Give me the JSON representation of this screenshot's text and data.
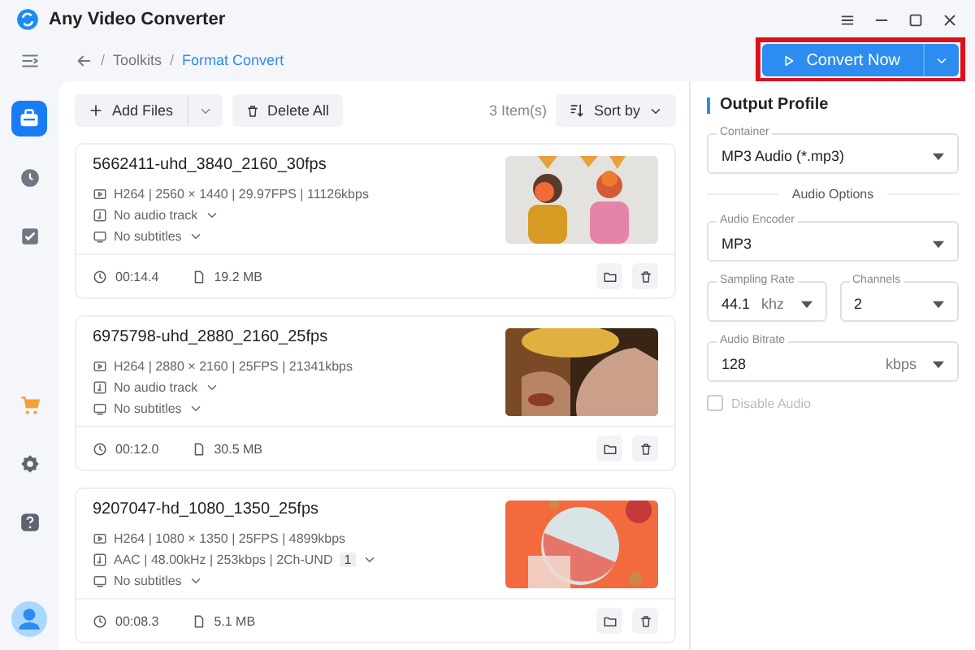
{
  "app": {
    "title": "Any Video Converter"
  },
  "sidebar": {
    "items": [
      {
        "kind": "menu",
        "selected": false
      },
      {
        "kind": "toolbox",
        "selected": true
      },
      {
        "kind": "history",
        "selected": false
      },
      {
        "kind": "tasks",
        "selected": false
      },
      {
        "kind": "cart",
        "selected": false
      },
      {
        "kind": "settings",
        "selected": false
      },
      {
        "kind": "help",
        "selected": false
      },
      {
        "kind": "avatar",
        "selected": false
      }
    ]
  },
  "breadcrumb": [
    {
      "separator": "/",
      "label": "Toolkits",
      "selected": false
    },
    {
      "separator": "/",
      "label": "Format Convert",
      "selected": true
    }
  ],
  "convert_button": {
    "label": "Convert Now",
    "highlighted": true
  },
  "toolbar": {
    "add_files": "Add Files",
    "delete_all": "Delete All",
    "count": "3 Item(s)",
    "sort": "Sort by"
  },
  "files": [
    {
      "name": "5662411-uhd_3840_2160_30fps",
      "video": "H264 | 2560 × 1440 | 29.97FPS | 11126kbps",
      "audio": "No audio track",
      "subtitles": "No subtitles",
      "duration": "00:14.4",
      "size": "19.2 MB"
    },
    {
      "name": "6975798-uhd_2880_2160_25fps",
      "video": "H264 | 2880 × 2160 | 25FPS | 21341kbps",
      "audio": "No audio track",
      "subtitles": "No subtitles",
      "duration": "00:12.0",
      "size": "30.5 MB"
    },
    {
      "name": "9207047-hd_1080_1350_25fps",
      "video": "H264 | 1080 × 1350 | 25FPS | 4899kbps",
      "audio": "AAC | 48.00kHz | 253kbps | 2Ch-UND",
      "audio_track_count": "1",
      "subtitles": "No subtitles",
      "duration": "00:08.3",
      "size": "5.1 MB"
    }
  ],
  "output_profile": {
    "title": "Output Profile",
    "container": {
      "label": "Container",
      "value": "MP3 Audio (*.mp3)"
    },
    "section": "Audio Options",
    "encoder": {
      "label": "Audio Encoder",
      "value": "MP3"
    },
    "sampling_rate": {
      "label": "Sampling Rate",
      "value": "44.1",
      "unit": "khz"
    },
    "channels": {
      "label": "Channels",
      "value": "2"
    },
    "bitrate": {
      "label": "Audio Bitrate",
      "value": "128",
      "unit": "kbps"
    },
    "disable_audio": {
      "label": "Disable Audio",
      "checked": false,
      "disabled": true
    }
  }
}
